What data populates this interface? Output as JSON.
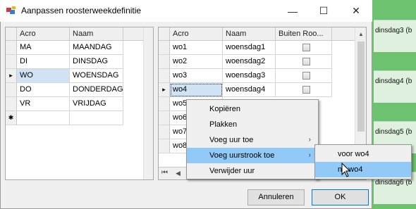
{
  "window": {
    "title": "Aanpassen roosterweekdefinitie",
    "controls": {
      "minimize": "—",
      "maximize": "☐",
      "close": "✕"
    }
  },
  "left_grid": {
    "columns": [
      "Acro",
      "Naam"
    ],
    "rows": [
      {
        "acro": "MA",
        "naam": "MAANDAG"
      },
      {
        "acro": "DI",
        "naam": "DINSDAG"
      },
      {
        "acro": "WO",
        "naam": "WOENSDAG"
      },
      {
        "acro": "DO",
        "naam": "DONDERDAG"
      },
      {
        "acro": "VR",
        "naam": "VRIJDAG"
      }
    ],
    "new_row_marker": "✱",
    "current_row_marker": "▸"
  },
  "right_grid": {
    "columns": [
      "Acro",
      "Naam",
      "Buiten Roo..."
    ],
    "rows": [
      {
        "acro": "wo1",
        "naam": "woensdag1"
      },
      {
        "acro": "wo2",
        "naam": "woensdag2"
      },
      {
        "acro": "wo3",
        "naam": "woensdag3"
      },
      {
        "acro": "wo4",
        "naam": "woensdag4"
      },
      {
        "acro": "wo5",
        "naam": ""
      },
      {
        "acro": "wo6",
        "naam": ""
      },
      {
        "acro": "wo7",
        "naam": ""
      },
      {
        "acro": "wo8",
        "naam": ""
      }
    ],
    "current_row_marker": "▸",
    "nav_first": "⏮",
    "nav_prev": "◀"
  },
  "context_menu": {
    "items": [
      {
        "label": "Kopiëren"
      },
      {
        "label": "Plakken"
      },
      {
        "label": "Voeg uur toe",
        "submenu": "›"
      },
      {
        "label": "Voeg uurstrook toe",
        "submenu": "›"
      },
      {
        "label": "Verwijder uur"
      }
    ]
  },
  "submenu": {
    "items": [
      {
        "label": "voor wo4"
      },
      {
        "label": "na wo4"
      }
    ]
  },
  "buttons": {
    "cancel": "Annuleren",
    "ok": "OK"
  },
  "background_app": {
    "labels": [
      "dinsdag3 (b",
      "dinsdag4 (b",
      "dinsdag5 (b",
      "dinsdag6 (b"
    ]
  },
  "colors": {
    "menu_highlight": "#91c9f7",
    "selection": "#cfe3f5",
    "bg_app": "#6cc26e"
  }
}
